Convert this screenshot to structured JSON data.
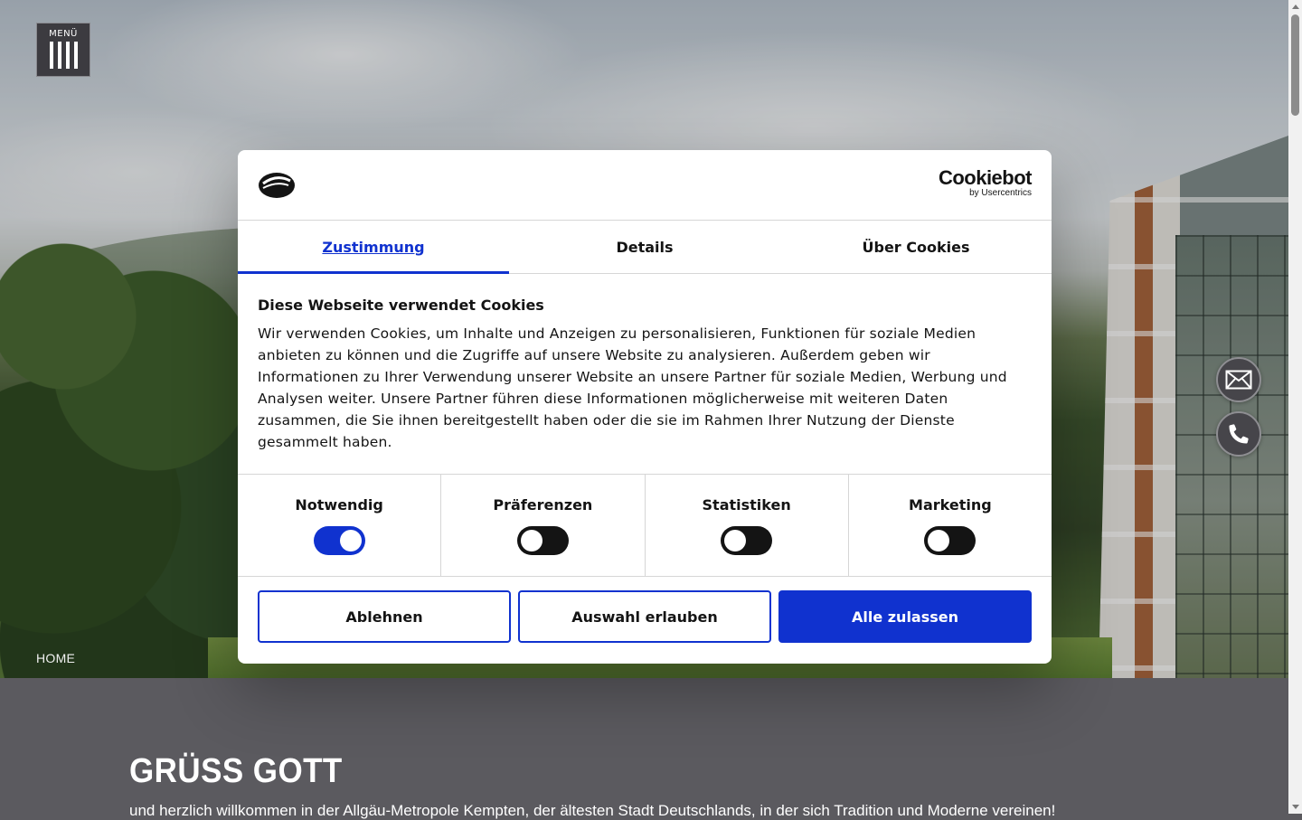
{
  "menu": {
    "label": "MENÜ"
  },
  "breadcrumb": {
    "home": "HOME"
  },
  "intro": {
    "title": "GRÜSS GOTT",
    "text": "und herzlich willkommen in der Allgäu-Metropole Kempten, der ältesten Stadt Deutschlands, in der sich Tradition und Moderne vereinen!"
  },
  "cookie": {
    "brand": {
      "name": "Cookiebot",
      "sub": "by Usercentrics"
    },
    "tabs": [
      {
        "label": "Zustimmung",
        "active": true
      },
      {
        "label": "Details",
        "active": false
      },
      {
        "label": "Über Cookies",
        "active": false
      }
    ],
    "heading": "Diese Webseite verwendet Cookies",
    "body": "Wir verwenden Cookies, um Inhalte und Anzeigen zu personalisieren, Funktionen für soziale Medien anbieten zu können und die Zugriffe auf unsere Website zu analysieren. Außerdem geben wir Informationen zu Ihrer Verwendung unserer Website an unsere Partner für soziale Medien, Werbung und Analysen weiter. Unsere Partner führen diese Informationen möglicherweise mit weiteren Daten zusammen, die Sie ihnen bereitgestellt haben oder die sie im Rahmen Ihrer Nutzung der Dienste gesammelt haben.",
    "categories": [
      {
        "label": "Notwendig",
        "enabled": true
      },
      {
        "label": "Präferenzen",
        "enabled": false
      },
      {
        "label": "Statistiken",
        "enabled": false
      },
      {
        "label": "Marketing",
        "enabled": false
      }
    ],
    "buttons": {
      "decline": "Ablehnen",
      "allow_selection": "Auswahl erlauben",
      "allow_all": "Alle zulassen"
    }
  },
  "colors": {
    "accent": "#1032cf",
    "dark_panel": "#5b5a5f",
    "toggle_off": "#141414"
  },
  "icons": [
    "menu-icon",
    "mail-icon",
    "phone-icon",
    "cookie-logo-icon"
  ]
}
